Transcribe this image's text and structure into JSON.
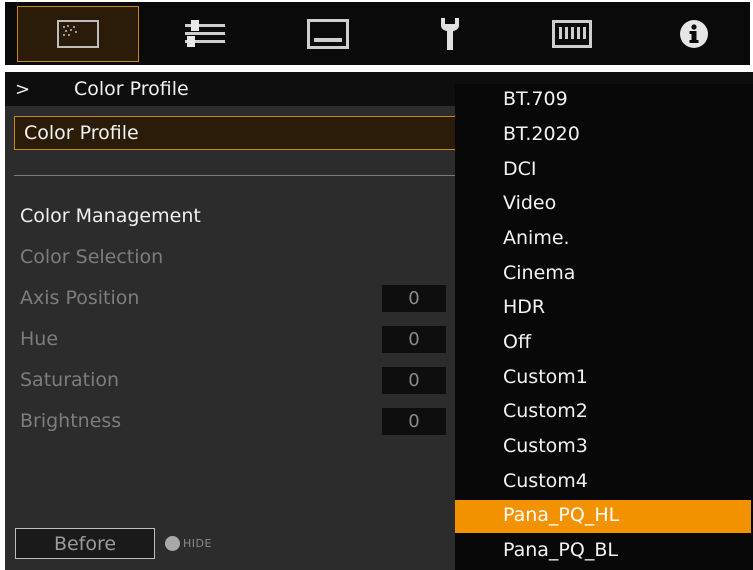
{
  "tabs": [
    {
      "name": "picture",
      "icon": "picture-icon",
      "active": true
    },
    {
      "name": "position",
      "icon": "sliders-icon",
      "active": false
    },
    {
      "name": "display",
      "icon": "display-icon",
      "active": false
    },
    {
      "name": "setup",
      "icon": "wrench-icon",
      "active": false
    },
    {
      "name": "network",
      "icon": "network-icon",
      "active": false
    },
    {
      "name": "information",
      "icon": "info-icon",
      "active": false
    }
  ],
  "breadcrumb": {
    "arrow": ">",
    "title": "Color Profile"
  },
  "menu": {
    "color_profile_label": "Color Profile",
    "color_management_label": "Color Management",
    "color_selection_label": "Color Selection",
    "axis_position": {
      "label": "Axis Position",
      "value": "0"
    },
    "hue": {
      "label": "Hue",
      "value": "0"
    },
    "saturation": {
      "label": "Saturation",
      "value": "0"
    },
    "brightness": {
      "label": "Brightness",
      "value": "0"
    }
  },
  "footer": {
    "before_label": "Before",
    "hide_label": "HIDE"
  },
  "dropdown": {
    "options": [
      "BT.709",
      "BT.2020",
      "DCI",
      "Video",
      "Anime.",
      "Cinema",
      "HDR",
      "Off",
      "Custom1",
      "Custom2",
      "Custom3",
      "Custom4",
      "Pana_PQ_HL",
      "Pana_PQ_BL"
    ],
    "selected": "Pana_PQ_HL"
  },
  "colors": {
    "accent": "#f39200",
    "active_border": "#c9861a",
    "panel": "#2c2c2c"
  }
}
